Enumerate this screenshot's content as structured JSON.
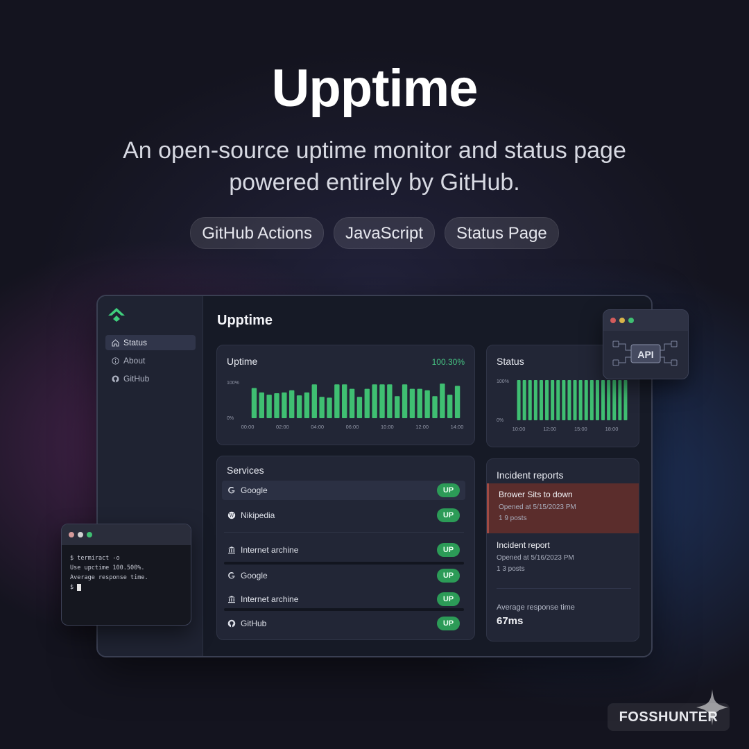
{
  "hero": {
    "title": "Upptime",
    "subtitle": "An open-source uptime monitor and status page powered entirely by GitHub.",
    "tags": [
      "GitHub Actions",
      "JavaScript",
      "Status Page"
    ]
  },
  "app": {
    "sidebar": {
      "items": [
        {
          "label": "Status",
          "icon": "home-icon",
          "active": true
        },
        {
          "label": "About",
          "icon": "info-icon",
          "active": false
        },
        {
          "label": "GitHub",
          "icon": "github-icon",
          "active": false
        }
      ]
    },
    "title": "Upptime",
    "uptime_card": {
      "title": "Uptime",
      "percent": "100.30%"
    },
    "status_card": {
      "title": "Status"
    },
    "services": {
      "title": "Services",
      "items": [
        {
          "name": "Google",
          "icon": "google-icon",
          "status": "UP"
        },
        {
          "name": "Nikipedia",
          "icon": "wikipedia-icon",
          "status": "UP"
        },
        {
          "name": "Internet archine",
          "icon": "archive-icon",
          "status": "UP"
        },
        {
          "name": "Google",
          "icon": "google-icon",
          "status": "UP"
        },
        {
          "name": "Internet archine",
          "icon": "archive-icon",
          "status": "UP"
        },
        {
          "name": "GitHub",
          "icon": "github-icon",
          "status": "UP"
        }
      ]
    },
    "incidents": {
      "title": "Incident reports",
      "items": [
        {
          "title": "Brower Sits to down",
          "opened": "Opened at 5/15/2023 PM",
          "posts": "1 9 posts"
        },
        {
          "title": "Incident report",
          "opened": "Opened at 5/16/2023 PM",
          "posts": "1 3 posts"
        }
      ],
      "avg_label": "Average response time",
      "avg_value": "67ms"
    }
  },
  "api_window": {
    "label": "API"
  },
  "terminal": {
    "lines": [
      "$ termiract -o",
      "Use upctime 100.500%.",
      "Average response time."
    ],
    "prompt": "$"
  },
  "watermark": "FOSSHUNTER",
  "colors": {
    "accent_green": "#2c9b57",
    "bar_green": "#3fbf72",
    "alert_red": "#5b2d2c"
  },
  "chart_data": [
    {
      "type": "bar",
      "title": "Uptime",
      "x_ticks": [
        "00:00",
        "02:00",
        "04:00",
        "06:00",
        "10:00",
        "12:00",
        "14:00"
      ],
      "y_ticks": [
        "100%",
        "0%"
      ],
      "ylim": [
        0,
        100
      ],
      "values": [
        82,
        70,
        64,
        68,
        70,
        76,
        62,
        70,
        92,
        58,
        56,
        92,
        92,
        80,
        58,
        80,
        92,
        92,
        92,
        60,
        92,
        80,
        80,
        76,
        60,
        94,
        64,
        88
      ]
    },
    {
      "type": "bar",
      "title": "Status",
      "x_ticks": [
        "10:00",
        "12:00",
        "15:00",
        "18:00"
      ],
      "y_ticks": [
        "100%",
        "0%"
      ],
      "ylim": [
        0,
        100
      ],
      "values": [
        100,
        100,
        100,
        100,
        100,
        100,
        100,
        100,
        100,
        100,
        100,
        100,
        100,
        100,
        100,
        100,
        100,
        100,
        100,
        100
      ]
    }
  ]
}
